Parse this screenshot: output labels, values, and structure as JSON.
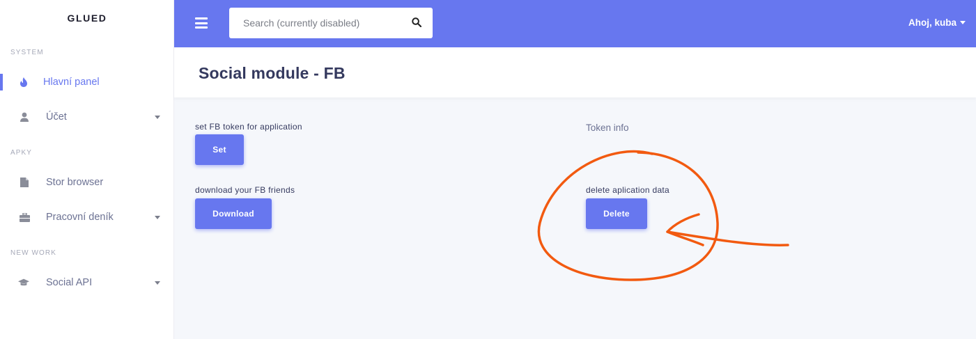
{
  "app": {
    "brand": "GLUED"
  },
  "sidebar": {
    "sections": [
      "SYSTEM",
      "APKY",
      "NEW WORK"
    ],
    "items": [
      {
        "label": "Hlavní panel",
        "icon": "fire-icon",
        "active": true
      },
      {
        "label": "Účet",
        "icon": "user-icon",
        "expandable": true
      },
      {
        "label": "Stor browser",
        "icon": "file-icon"
      },
      {
        "label": "Pracovní deník",
        "icon": "briefcase-icon",
        "expandable": true
      },
      {
        "label": "Social API",
        "icon": "graduation-cap-icon",
        "expandable": true
      }
    ]
  },
  "topbar": {
    "search_placeholder": "Search (currently disabled)",
    "user_label": "Ahoj, kuba"
  },
  "page": {
    "title": "Social module - FB"
  },
  "content": {
    "set_token_label": "set FB token for application",
    "set_button": "Set",
    "download_label": "download your FB friends",
    "download_button": "Download",
    "token_info": "Token info",
    "delete_label": "delete aplication data",
    "delete_button": "Delete"
  },
  "colors": {
    "accent": "#6777ef",
    "annotation": "#f25a10"
  }
}
